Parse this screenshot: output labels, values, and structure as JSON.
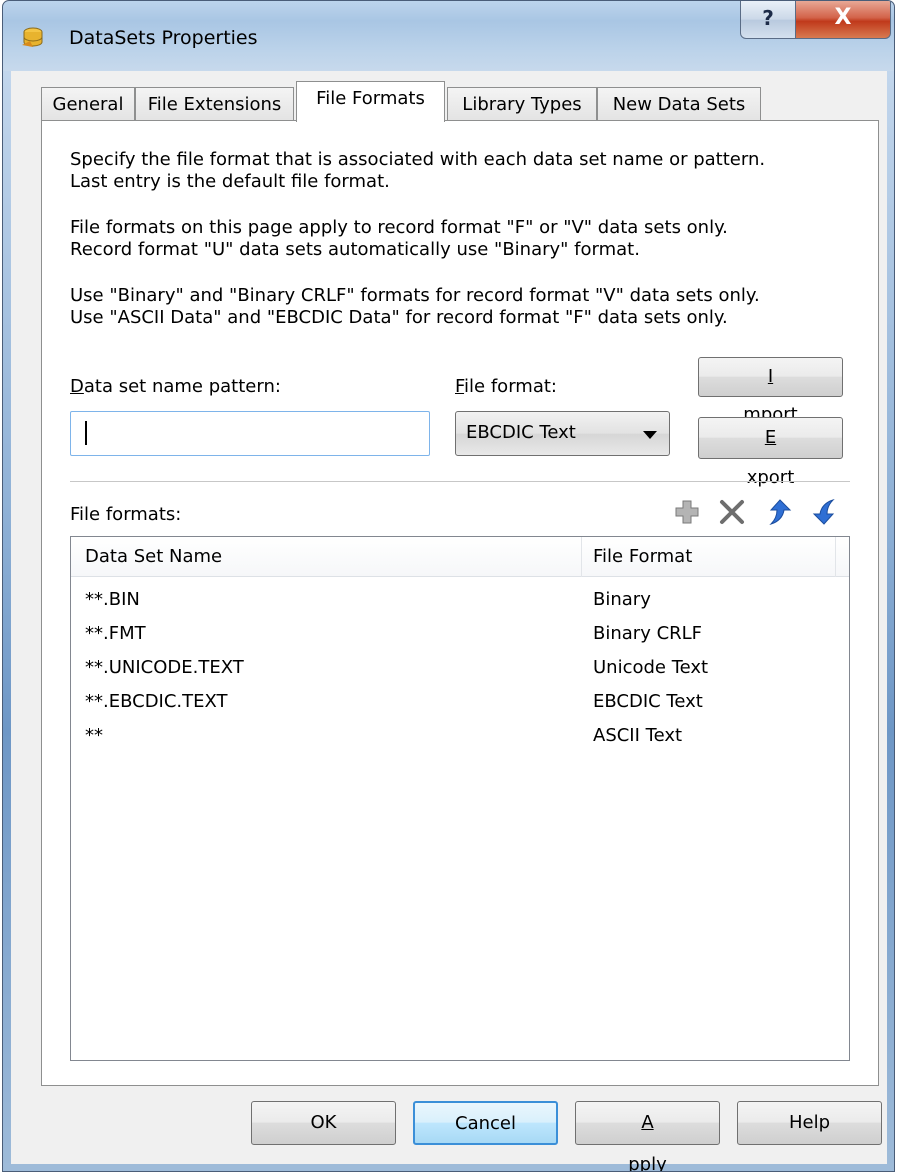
{
  "window": {
    "title": "DataSets Properties",
    "help_glyph": "?",
    "close_glyph": "X"
  },
  "tabs": [
    {
      "label": "General"
    },
    {
      "label": "File Extensions"
    },
    {
      "label": "File Formats"
    },
    {
      "label": "Library Types"
    },
    {
      "label": "New Data Sets"
    }
  ],
  "active_tab": "File Formats",
  "description": {
    "p1": [
      "Specify the file format that is associated with each data set name or pattern.",
      "Last entry is the default file format."
    ],
    "p2": [
      "File formats on this page apply to record format \"F\" or \"V\" data sets only.",
      "Record format \"U\" data sets automatically use \"Binary\" format."
    ],
    "p3": [
      "Use \"Binary\" and \"Binary CRLF\" formats for record format \"V\" data sets only.",
      "Use \"ASCII Data\" and \"EBCDIC Data\" for record format \"F\" data sets only."
    ]
  },
  "pattern": {
    "label_mnemonic": "D",
    "label_rest": "ata set name pattern:",
    "value": ""
  },
  "format": {
    "label_mnemonic": "F",
    "label_rest": "ile format:",
    "selected": "EBCDIC Text"
  },
  "buttons": {
    "import_mnemonic": "I",
    "import_rest": "mport",
    "export_mnemonic": "E",
    "export_rest": "xport"
  },
  "list": {
    "label": "File formats:",
    "columns": [
      "Data Set Name",
      "File Format"
    ],
    "rows": [
      {
        "name": "**.BIN",
        "format": "Binary"
      },
      {
        "name": "**.FMT",
        "format": "Binary CRLF"
      },
      {
        "name": "**.UNICODE.TEXT",
        "format": "Unicode Text"
      },
      {
        "name": "**.EBCDIC.TEXT",
        "format": "EBCDIC Text"
      },
      {
        "name": "**",
        "format": "ASCII Text"
      }
    ]
  },
  "toolbar_icons": [
    "add-icon",
    "delete-icon",
    "move-up-icon",
    "move-down-icon"
  ],
  "footer": {
    "ok": "OK",
    "cancel": "Cancel",
    "apply_mnemonic": "A",
    "apply_rest": "pply",
    "help": "Help"
  },
  "colors": {
    "accent": "#3b8fd8",
    "arrow_blue": "#2f6fd4",
    "close_red": "#c0391b"
  }
}
